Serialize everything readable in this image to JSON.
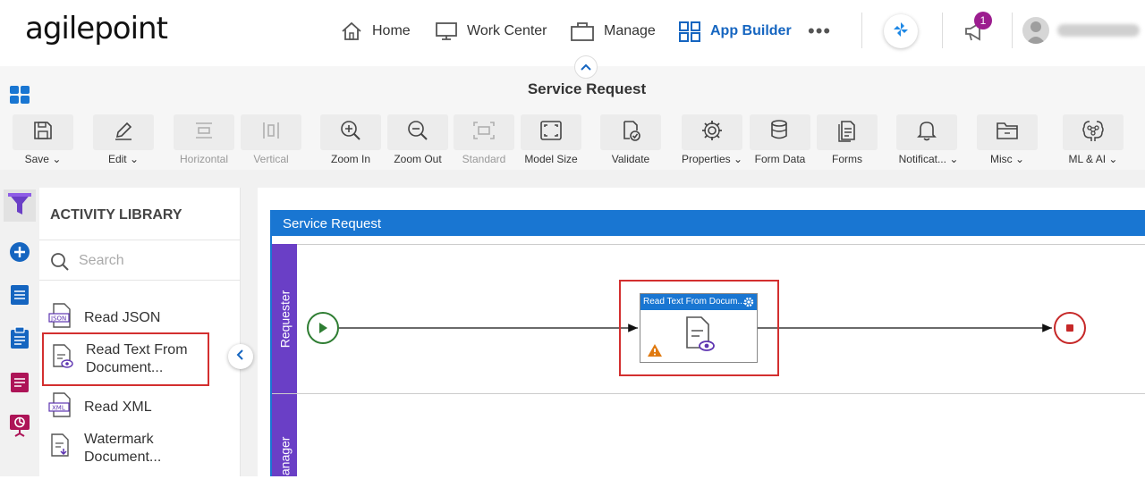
{
  "brand": {
    "logo_text": "agilepoint"
  },
  "nav": {
    "items": [
      {
        "label": "Home"
      },
      {
        "label": "Work Center"
      },
      {
        "label": "Manage"
      },
      {
        "label": "App Builder"
      }
    ],
    "more_label": "•••",
    "notification_count": "1",
    "accent_color": "#1565c0"
  },
  "page": {
    "title": "Service Request"
  },
  "toolbar": {
    "items": [
      {
        "label": "Save",
        "icon": "save-icon",
        "dropdown": true
      },
      {
        "label": "Edit",
        "icon": "pencil-icon",
        "dropdown": true
      },
      {
        "label": "Horizontal",
        "icon": "horizontal-icon",
        "disabled": true
      },
      {
        "label": "Vertical",
        "icon": "vertical-icon",
        "disabled": true
      },
      {
        "label": "Zoom In",
        "icon": "zoom-in-icon"
      },
      {
        "label": "Zoom Out",
        "icon": "zoom-out-icon"
      },
      {
        "label": "Standard",
        "icon": "standard-icon",
        "disabled": true
      },
      {
        "label": "Model Size",
        "icon": "model-size-icon"
      },
      {
        "label": "Validate",
        "icon": "validate-icon"
      },
      {
        "label": "Properties",
        "icon": "gear-icon",
        "dropdown": true
      },
      {
        "label": "Form Data",
        "icon": "database-icon"
      },
      {
        "label": "Forms",
        "icon": "forms-icon"
      },
      {
        "label": "Notificat...",
        "icon": "bell-icon",
        "dropdown": true
      },
      {
        "label": "Misc",
        "icon": "folder-icon",
        "dropdown": true
      },
      {
        "label": "ML & AI",
        "icon": "ai-brain-icon",
        "dropdown": true
      }
    ]
  },
  "library": {
    "title": "ACTIVITY LIBRARY",
    "search_placeholder": "Search",
    "items": [
      {
        "label": "Read JSON"
      },
      {
        "label": "Read Text From Document..."
      },
      {
        "label": "Read XML"
      },
      {
        "label": "Watermark Document..."
      }
    ]
  },
  "process": {
    "pool_title": "Service Request",
    "lanes": [
      {
        "label": "Requester"
      },
      {
        "label": "e Manager"
      }
    ],
    "activity": {
      "label": "Read Text From Docum..."
    },
    "colors": {
      "pool": "#1976d2",
      "lane": "#6a3fc6",
      "start": "#2e7d32",
      "end": "#c62828",
      "highlight": "#d32f2f"
    }
  }
}
